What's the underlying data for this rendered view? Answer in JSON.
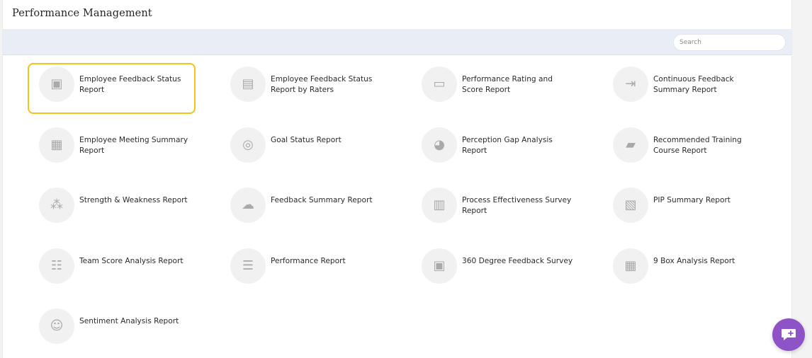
{
  "page": {
    "title": "Performance Management"
  },
  "search": {
    "placeholder": "Search"
  },
  "reports": [
    {
      "label": "Employee Feedback Status Report",
      "icon": "presenter-board-icon",
      "glyph": "▣",
      "highlighted": true
    },
    {
      "label": "Employee Feedback Status Report by Raters",
      "icon": "presenter-raters-icon",
      "glyph": "▤"
    },
    {
      "label": "Performance Rating and Score Report",
      "icon": "monitor-chart-icon",
      "glyph": "▭"
    },
    {
      "label": "Continuous Feedback Summary Report",
      "icon": "document-arrow-icon",
      "glyph": "⇥"
    },
    {
      "label": "Employee Meeting Summary Report",
      "icon": "meeting-board-icon",
      "glyph": "▦"
    },
    {
      "label": "Goal Status Report",
      "icon": "target-icon",
      "glyph": "◎"
    },
    {
      "label": "Perception Gap Analysis Report",
      "icon": "pie-chart-icon",
      "glyph": "◕"
    },
    {
      "label": "Recommended Training Course Report",
      "icon": "book-icon",
      "glyph": "▰"
    },
    {
      "label": "Strength & Weakness Report",
      "icon": "hierarchy-icon",
      "glyph": "⁂"
    },
    {
      "label": "Feedback Summary Report",
      "icon": "chat-bubbles-icon",
      "glyph": "☁"
    },
    {
      "label": "Process Effectiveness Survey Report",
      "icon": "survey-document-icon",
      "glyph": "▥"
    },
    {
      "label": "PIP Summary Report",
      "icon": "board-chart-icon",
      "glyph": "▧"
    },
    {
      "label": "Team Score Analysis Report",
      "icon": "team-board-icon",
      "glyph": "☷"
    },
    {
      "label": "Performance Report",
      "icon": "team-report-icon",
      "glyph": "☰"
    },
    {
      "label": "360 Degree Feedback Survey",
      "icon": "presenter-board-icon",
      "glyph": "▣"
    },
    {
      "label": "9 Box Analysis Report",
      "icon": "nine-box-grid-icon",
      "glyph": "▦"
    },
    {
      "label": "Sentiment Analysis Report",
      "icon": "emotion-faces-icon",
      "glyph": "☺"
    }
  ],
  "chat": {
    "icon": "chat-plus-icon"
  },
  "colors": {
    "accent": "#8e54c7",
    "highlight": "#f2c318",
    "toolbar": "#e9edf5"
  }
}
